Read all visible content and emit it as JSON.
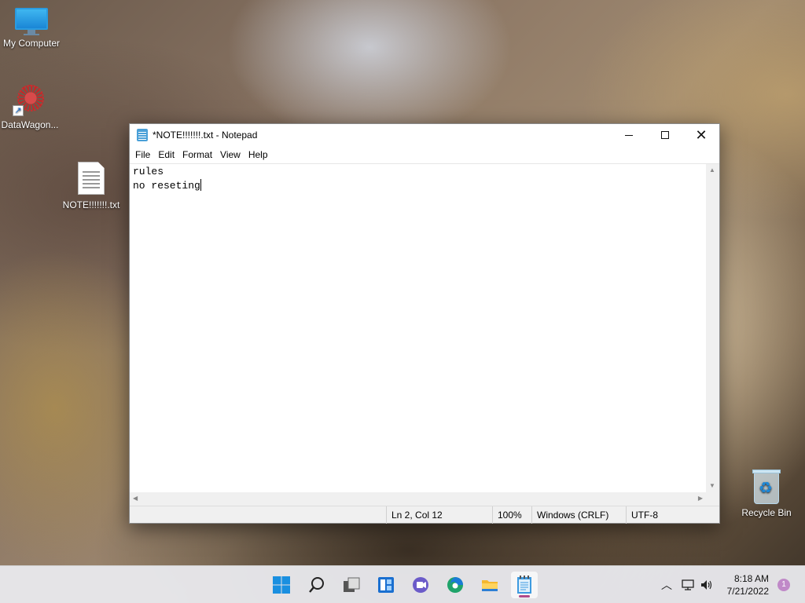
{
  "desktop": {
    "icons": [
      {
        "label": "My Computer",
        "icon": "monitor-icon"
      },
      {
        "label": "DataWagon...",
        "icon": "shortcut-icon"
      },
      {
        "label": "NOTE!!!!!!!.txt",
        "icon": "text-file-icon"
      },
      {
        "label": "Recycle Bin",
        "icon": "recycle-bin-icon"
      }
    ]
  },
  "notepad": {
    "title": "*NOTE!!!!!!!.txt - Notepad",
    "menu": [
      "File",
      "Edit",
      "Format",
      "View",
      "Help"
    ],
    "content_lines": [
      "rules",
      "no reseting"
    ],
    "status": {
      "position": "Ln 2, Col 12",
      "zoom": "100%",
      "line_ending": "Windows (CRLF)",
      "encoding": "UTF-8"
    }
  },
  "taskbar": {
    "apps": [
      "start-icon",
      "search-icon",
      "task-view-icon",
      "widgets-icon",
      "chat-icon",
      "edge-icon",
      "file-explorer-icon",
      "notepad-icon"
    ],
    "active_app": "notepad-icon",
    "clock": {
      "time": "8:18 AM",
      "date": "7/21/2022"
    },
    "notification_count": "1"
  },
  "colors": {
    "accent": "#0078d4",
    "taskbar_bg": "#e8e8ec",
    "active_indicator": "#b04a8a"
  }
}
